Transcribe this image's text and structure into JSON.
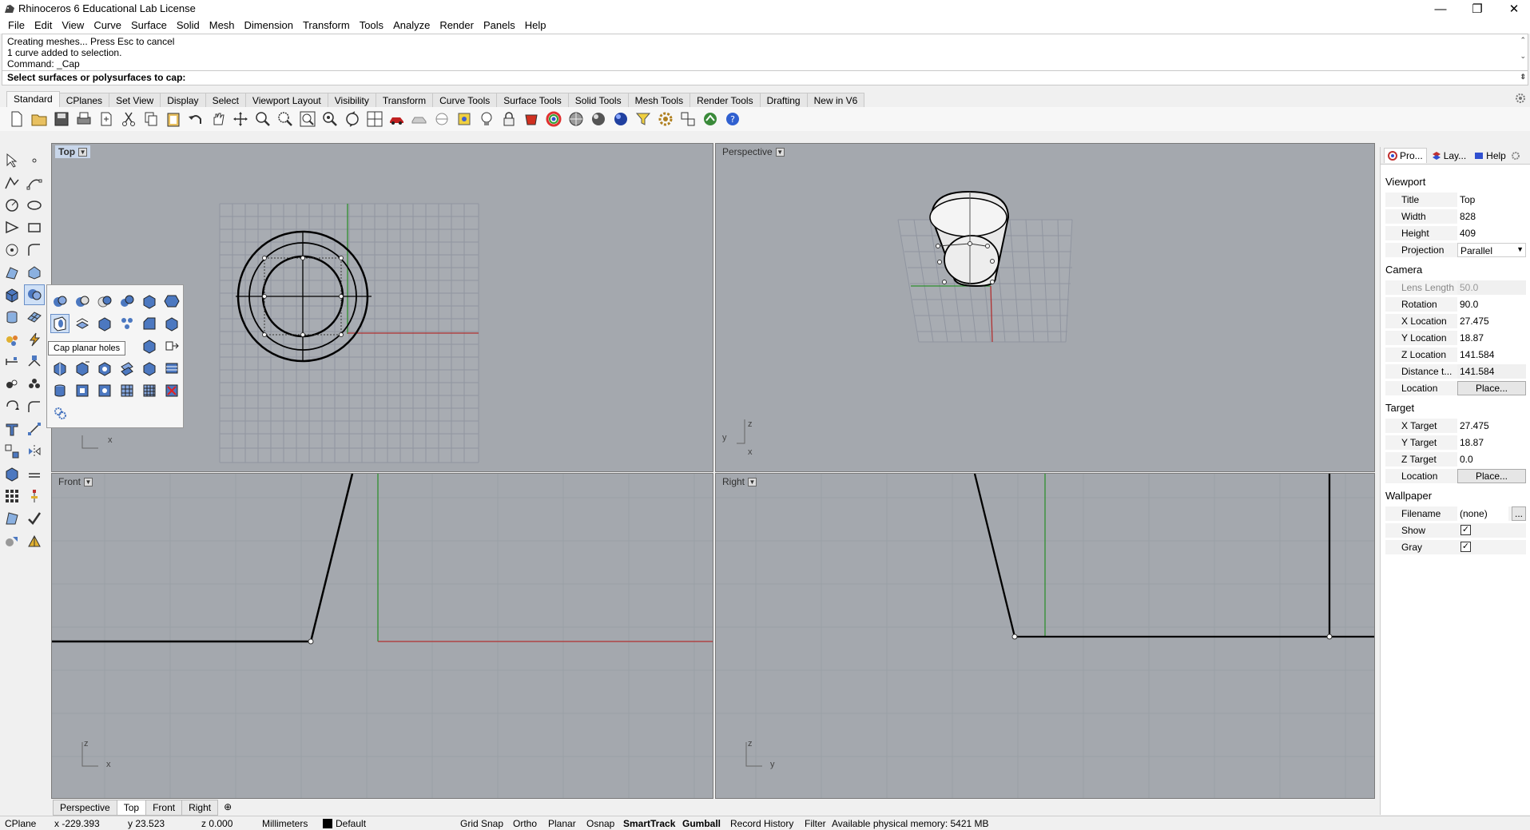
{
  "window": {
    "title": "Rhinoceros 6 Educational Lab License",
    "minimize": "—",
    "restore": "❐",
    "close": "✕"
  },
  "menu": [
    "File",
    "Edit",
    "View",
    "Curve",
    "Surface",
    "Solid",
    "Mesh",
    "Dimension",
    "Transform",
    "Tools",
    "Analyze",
    "Render",
    "Panels",
    "Help"
  ],
  "command": {
    "history": [
      "Creating meshes... Press Esc to cancel",
      "1 curve added to selection.",
      "Command: _Cap"
    ],
    "prompt": "Select surfaces or polysurfaces to cap:"
  },
  "toolbar_tabs": [
    "Standard",
    "CPlanes",
    "Set View",
    "Display",
    "Select",
    "Viewport Layout",
    "Visibility",
    "Transform",
    "Curve Tools",
    "Surface Tools",
    "Solid Tools",
    "Mesh Tools",
    "Render Tools",
    "Drafting",
    "New in V6"
  ],
  "toolbar_active": "Standard",
  "toolbar_icons": [
    "new-icon",
    "open-icon",
    "save-icon",
    "print-icon",
    "import-icon",
    "cut-icon",
    "copy-icon",
    "paste-icon",
    "undo-icon",
    "pan-icon",
    "rotate-view-icon",
    "zoom-icon",
    "zoom-window-icon",
    "zoom-extents-icon",
    "zoom-selected-icon",
    "zoom-rotate-icon",
    "four-viewports-icon",
    "car-icon",
    "ghosted-icon",
    "cplane-icon",
    "snap-icon",
    "light-icon",
    "lock-icon",
    "material-icon",
    "color-wheel-icon",
    "render-preview-icon",
    "render-sphere-icon",
    "render-blue-icon",
    "filter-icon",
    "options-gear-icon",
    "osnap-icon",
    "grasshopper-icon",
    "help-icon"
  ],
  "viewports": {
    "top": {
      "label": "Top",
      "axis_x": "x"
    },
    "perspective": {
      "label": "Perspective",
      "axis_y": "y",
      "axis_z": "z",
      "axis_x": "x"
    },
    "front": {
      "label": "Front",
      "axis_z": "z",
      "axis_x": "x"
    },
    "right": {
      "label": "Right",
      "axis_z": "z",
      "axis_y": "y"
    }
  },
  "flyout": {
    "tooltip": "Cap planar holes"
  },
  "viewport_tabs": [
    "Perspective",
    "Top",
    "Front",
    "Right"
  ],
  "viewport_tab_add": "⊕",
  "status": {
    "cplane": "CPlane",
    "x": "x -229.393",
    "y": "y 23.523",
    "z": "z 0.000",
    "units": "Millimeters",
    "layer": "Default",
    "grid_snap": "Grid Snap",
    "ortho": "Ortho",
    "planar": "Planar",
    "osnap": "Osnap",
    "smarttrack": "SmartTrack",
    "gumball": "Gumball",
    "record_history": "Record History",
    "filter": "Filter",
    "memory": "Available physical memory: 5421 MB"
  },
  "panel": {
    "tabs": [
      "Pro...",
      "Lay...",
      "Help"
    ],
    "viewport_section": "Viewport",
    "title_label": "Title",
    "title_value": "Top",
    "width_label": "Width",
    "width_value": "828",
    "height_label": "Height",
    "height_value": "409",
    "projection_label": "Projection",
    "projection_value": "Parallel",
    "camera_section": "Camera",
    "lens_label": "Lens Length",
    "lens_value": "50.0",
    "rotation_label": "Rotation",
    "rotation_value": "90.0",
    "xloc_label": "X Location",
    "xloc_value": "27.475",
    "yloc_label": "Y Location",
    "yloc_value": "18.87",
    "zloc_label": "Z Location",
    "zloc_value": "141.584",
    "dist_label": "Distance t...",
    "dist_value": "141.584",
    "location_label": "Location",
    "place_button": "Place...",
    "target_section": "Target",
    "xtarget_label": "X Target",
    "xtarget_value": "27.475",
    "ytarget_label": "Y Target",
    "ytarget_value": "18.87",
    "ztarget_label": "Z Target",
    "ztarget_value": "0.0",
    "tlocation_label": "Location",
    "tplace_button": "Place...",
    "wallpaper_section": "Wallpaper",
    "filename_label": "Filename",
    "filename_value": "(none)",
    "filename_button": "...",
    "show_label": "Show",
    "show_checked": "✓",
    "gray_label": "Gray",
    "gray_checked": "✓"
  },
  "colors": {
    "viewport_bg": "#a4a8ae",
    "grid_line": "#959aa1",
    "x_axis": "#b03030",
    "y_axis": "#2f8f2f",
    "active_label": "#c8d6ea"
  }
}
